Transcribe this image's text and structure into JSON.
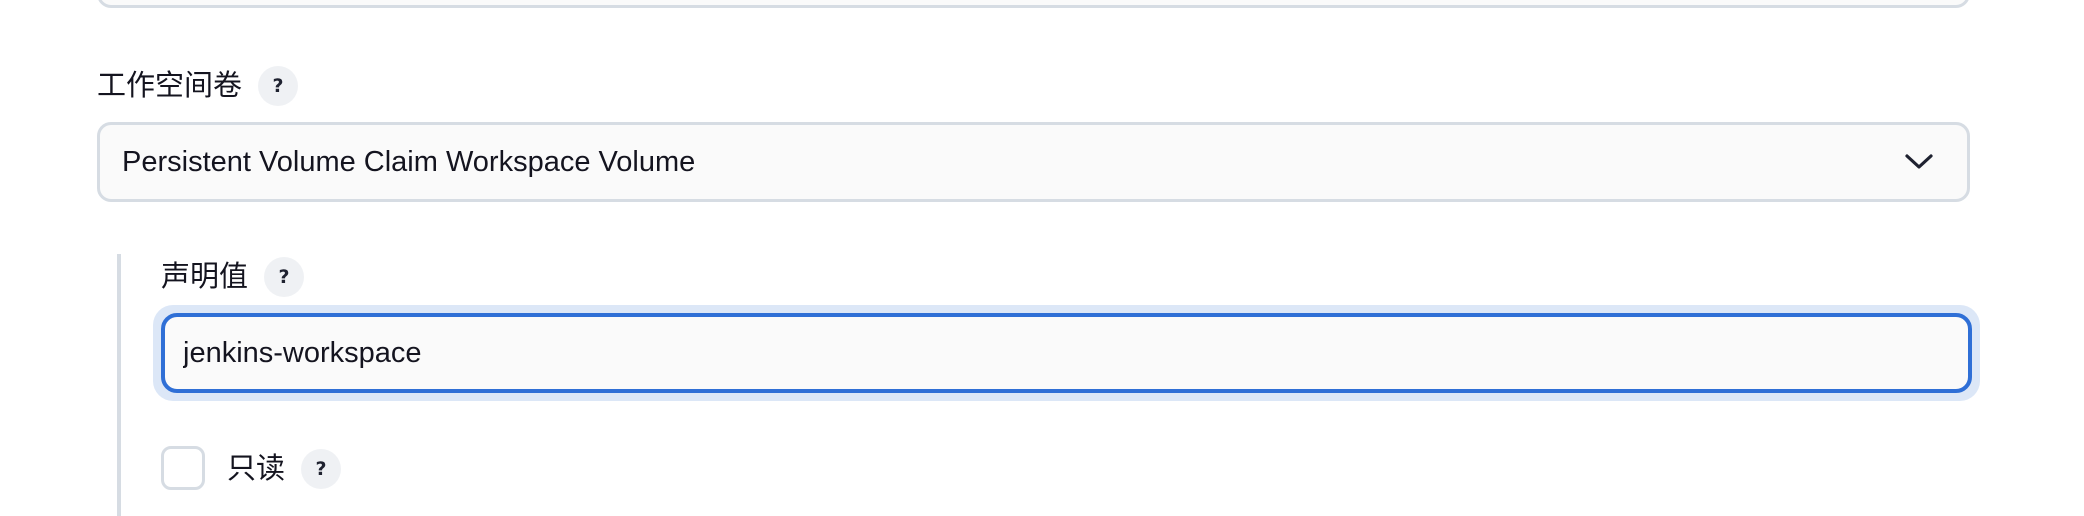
{
  "workspace_volume": {
    "label": "工作空间卷",
    "help": "?",
    "selected_value": "Persistent Volume Claim Workspace Volume",
    "dropdown_icon": "chevron-down-icon"
  },
  "claim_name": {
    "label": "声明值",
    "help": "?",
    "value": "jenkins-workspace"
  },
  "read_only": {
    "label": "只读",
    "help": "?",
    "checked": false
  },
  "colors": {
    "focus_border": "#2f6fd6",
    "focus_ring": "#dce7f7",
    "field_border": "#d6dce3",
    "help_bg": "#eff1f4"
  }
}
